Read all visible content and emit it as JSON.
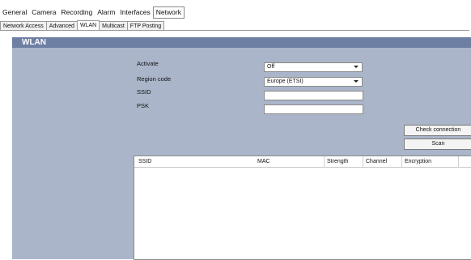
{
  "menu": [
    "General",
    "Camera",
    "Recording",
    "Alarm",
    "Interfaces",
    "Network"
  ],
  "tabs": [
    "Network Access",
    "Advanced",
    "WLAN",
    "Multicast",
    "FTP Posting"
  ],
  "section": {
    "title": "WLAN"
  },
  "form": {
    "activate_label": "Activate",
    "activate_value": "Off",
    "region_label": "Region code",
    "region_value": "Europe (ETSI)",
    "ssid_label": "SSID",
    "ssid_value": "",
    "psk_label": "PSK",
    "psk_value": ""
  },
  "buttons": {
    "check_connection": "Check connection",
    "scan": "Scan"
  },
  "table": {
    "columns": [
      "SSID",
      "MAC",
      "Strength",
      "Channel",
      "Encryption"
    ],
    "rows": []
  }
}
